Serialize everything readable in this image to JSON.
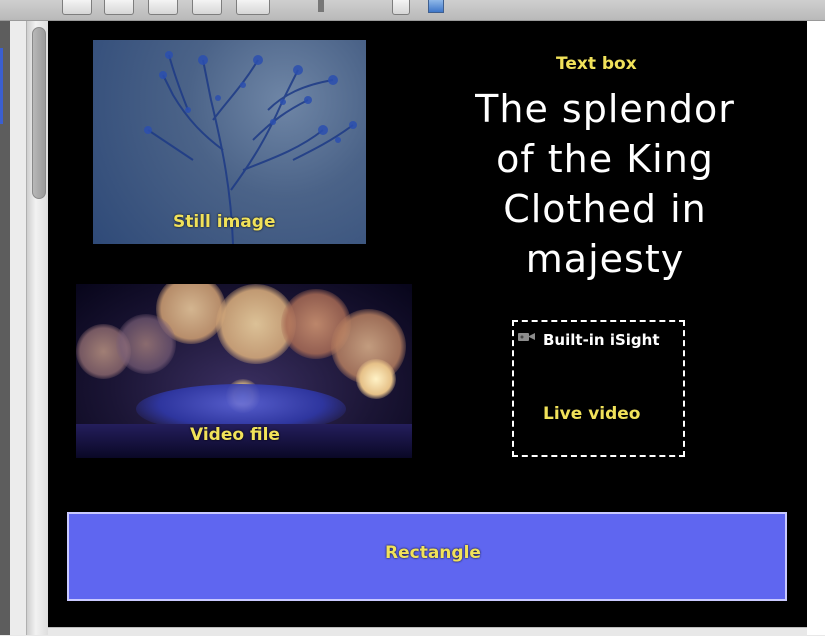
{
  "layers": {
    "still_image": {
      "label": "Still image"
    },
    "video_file": {
      "label": "Video file"
    },
    "text_box": {
      "label": "Text box",
      "lines": [
        "The splendor",
        "of the King",
        "Clothed in",
        "majesty"
      ]
    },
    "live_video": {
      "label": "Live video",
      "camera_name": "Built-in iSight",
      "camera_icon": "camera-icon"
    },
    "rectangle": {
      "label": "Rectangle",
      "color": "#5f66f0"
    }
  },
  "colors": {
    "canvas": "#000000",
    "label_yellow": "#f1e25a",
    "text_white": "#ffffff"
  }
}
